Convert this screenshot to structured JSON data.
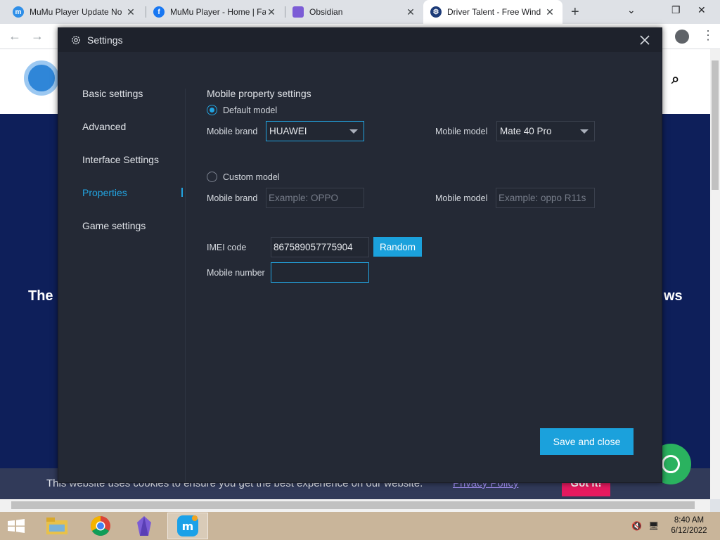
{
  "browser": {
    "tabs": [
      {
        "title": "MuMu Player Update No",
        "icon": "mumu-icon",
        "active": false
      },
      {
        "title": "MuMu Player - Home | Fa",
        "icon": "facebook-icon",
        "active": false
      },
      {
        "title": "Obsidian",
        "icon": "obsidian-icon",
        "active": false
      },
      {
        "title": "Driver Talent - Free Wind",
        "icon": "driver-talent-icon",
        "active": true
      }
    ]
  },
  "website": {
    "hero_left": "The",
    "hero_right": "ws",
    "cookie_message": "This website uses cookies to ensure you get the best experience on our website.",
    "cookie_link": "Privacy Policy",
    "cookie_button": "Got it!"
  },
  "dialog": {
    "title": "Settings",
    "sidebar": [
      {
        "label": "Basic settings",
        "active": false
      },
      {
        "label": "Advanced",
        "active": false
      },
      {
        "label": "Interface Settings",
        "active": false
      },
      {
        "label": "Properties",
        "active": true
      },
      {
        "label": "Game settings",
        "active": false
      }
    ],
    "section_title": "Mobile property settings",
    "default_model": {
      "label": "Default model",
      "selected": true,
      "brand_label": "Mobile brand",
      "brand_value": "HUAWEI",
      "model_label": "Mobile model",
      "model_value": "Mate 40 Pro"
    },
    "custom_model": {
      "label": "Custom model",
      "selected": false,
      "brand_label": "Mobile brand",
      "brand_placeholder": "Example: OPPO",
      "model_label": "Mobile model",
      "model_placeholder": "Example: oppo R11s"
    },
    "imei": {
      "label": "IMEI code",
      "value": "867589057775904",
      "random_button": "Random"
    },
    "mobile_number": {
      "label": "Mobile number",
      "value": ""
    },
    "save_button": "Save and close",
    "accent_color": "#1ba1dc"
  },
  "taskbar": {
    "apps": [
      "file-explorer-icon",
      "chrome-icon",
      "obsidian-icon",
      "mumu-player-icon"
    ],
    "time": "8:40 AM",
    "date": "6/12/2022"
  }
}
